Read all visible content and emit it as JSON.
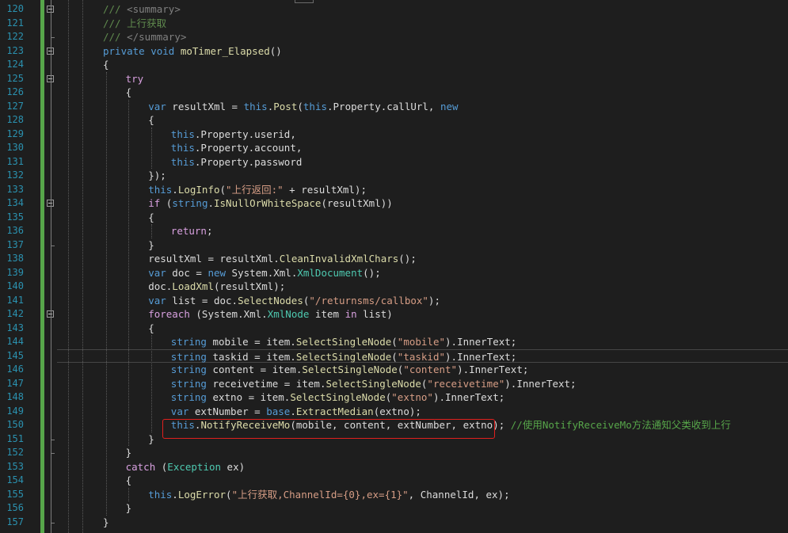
{
  "editor": {
    "language": "C#",
    "theme": "dark",
    "current_line": 145,
    "highlighted_line": 150,
    "lines": [
      {
        "n": 120,
        "tokens": [
          [
            "doc",
            "/// "
          ],
          [
            "docx",
            "<summary>"
          ]
        ]
      },
      {
        "n": 121,
        "tokens": [
          [
            "doc",
            "/// 上行获取"
          ]
        ]
      },
      {
        "n": 122,
        "tokens": [
          [
            "doc",
            "/// "
          ],
          [
            "docx",
            "</summary>"
          ]
        ]
      },
      {
        "n": 123,
        "tokens": [
          [
            "kw",
            "private"
          ],
          [
            "plain",
            " "
          ],
          [
            "kw",
            "void"
          ],
          [
            "plain",
            " "
          ],
          [
            "mth",
            "moTimer_Elapsed"
          ],
          [
            "plain",
            "()"
          ]
        ]
      },
      {
        "n": 124,
        "tokens": [
          [
            "plain",
            "{"
          ]
        ]
      },
      {
        "n": 125,
        "tokens": [
          [
            "ctl",
            "try"
          ]
        ]
      },
      {
        "n": 126,
        "tokens": [
          [
            "plain",
            "{"
          ]
        ]
      },
      {
        "n": 127,
        "tokens": [
          [
            "kw",
            "var"
          ],
          [
            "plain",
            " resultXml = "
          ],
          [
            "kw",
            "this"
          ],
          [
            "plain",
            "."
          ],
          [
            "mth",
            "Post"
          ],
          [
            "plain",
            "("
          ],
          [
            "kw",
            "this"
          ],
          [
            "plain",
            ".Property.callUrl, "
          ],
          [
            "kw",
            "new"
          ]
        ]
      },
      {
        "n": 128,
        "tokens": [
          [
            "plain",
            "{"
          ]
        ]
      },
      {
        "n": 129,
        "tokens": [
          [
            "kw",
            "this"
          ],
          [
            "plain",
            ".Property.userid,"
          ]
        ]
      },
      {
        "n": 130,
        "tokens": [
          [
            "kw",
            "this"
          ],
          [
            "plain",
            ".Property.account,"
          ]
        ]
      },
      {
        "n": 131,
        "tokens": [
          [
            "kw",
            "this"
          ],
          [
            "plain",
            ".Property.password"
          ]
        ]
      },
      {
        "n": 132,
        "tokens": [
          [
            "plain",
            "});"
          ]
        ]
      },
      {
        "n": 133,
        "tokens": [
          [
            "kw",
            "this"
          ],
          [
            "plain",
            "."
          ],
          [
            "mth",
            "LogInfo"
          ],
          [
            "plain",
            "("
          ],
          [
            "str",
            "\"上行返回:\""
          ],
          [
            "plain",
            " + resultXml);"
          ]
        ]
      },
      {
        "n": 134,
        "tokens": [
          [
            "ctl",
            "if"
          ],
          [
            "plain",
            " ("
          ],
          [
            "kw",
            "string"
          ],
          [
            "plain",
            "."
          ],
          [
            "mth",
            "IsNullOrWhiteSpace"
          ],
          [
            "plain",
            "(resultXml))"
          ]
        ]
      },
      {
        "n": 135,
        "tokens": [
          [
            "plain",
            "{"
          ]
        ]
      },
      {
        "n": 136,
        "tokens": [
          [
            "ctl",
            "return"
          ],
          [
            "plain",
            ";"
          ]
        ]
      },
      {
        "n": 137,
        "tokens": [
          [
            "plain",
            "}"
          ]
        ]
      },
      {
        "n": 138,
        "tokens": [
          [
            "plain",
            "resultXml = resultXml."
          ],
          [
            "mth",
            "CleanInvalidXmlChars"
          ],
          [
            "plain",
            "();"
          ]
        ]
      },
      {
        "n": 139,
        "tokens": [
          [
            "kw",
            "var"
          ],
          [
            "plain",
            " doc = "
          ],
          [
            "kw",
            "new"
          ],
          [
            "plain",
            " System.Xml."
          ],
          [
            "type",
            "XmlDocument"
          ],
          [
            "plain",
            "();"
          ]
        ]
      },
      {
        "n": 140,
        "tokens": [
          [
            "plain",
            "doc."
          ],
          [
            "mth",
            "LoadXml"
          ],
          [
            "plain",
            "(resultXml);"
          ]
        ]
      },
      {
        "n": 141,
        "tokens": [
          [
            "kw",
            "var"
          ],
          [
            "plain",
            " list = doc."
          ],
          [
            "mth",
            "SelectNodes"
          ],
          [
            "plain",
            "("
          ],
          [
            "str",
            "\"/returnsms/callbox\""
          ],
          [
            "plain",
            ");"
          ]
        ]
      },
      {
        "n": 142,
        "tokens": [
          [
            "ctl",
            "foreach"
          ],
          [
            "plain",
            " (System.Xml."
          ],
          [
            "type",
            "XmlNode"
          ],
          [
            "plain",
            " item "
          ],
          [
            "ctl",
            "in"
          ],
          [
            "plain",
            " list)"
          ]
        ]
      },
      {
        "n": 143,
        "tokens": [
          [
            "plain",
            "{"
          ]
        ]
      },
      {
        "n": 144,
        "tokens": [
          [
            "kw",
            "string"
          ],
          [
            "plain",
            " mobile = item."
          ],
          [
            "mth",
            "SelectSingleNode"
          ],
          [
            "plain",
            "("
          ],
          [
            "str",
            "\"mobile\""
          ],
          [
            "plain",
            ").InnerText;"
          ]
        ]
      },
      {
        "n": 145,
        "tokens": [
          [
            "kw",
            "string"
          ],
          [
            "plain",
            " taskid = item."
          ],
          [
            "mth",
            "SelectSingleNode"
          ],
          [
            "plain",
            "("
          ],
          [
            "str",
            "\"taskid\""
          ],
          [
            "plain",
            ").InnerText;"
          ]
        ]
      },
      {
        "n": 146,
        "tokens": [
          [
            "kw",
            "string"
          ],
          [
            "plain",
            " content = item."
          ],
          [
            "mth",
            "SelectSingleNode"
          ],
          [
            "plain",
            "("
          ],
          [
            "str",
            "\"content\""
          ],
          [
            "plain",
            ").InnerText;"
          ]
        ]
      },
      {
        "n": 147,
        "tokens": [
          [
            "kw",
            "string"
          ],
          [
            "plain",
            " receivetime = item."
          ],
          [
            "mth",
            "SelectSingleNode"
          ],
          [
            "plain",
            "("
          ],
          [
            "str",
            "\"receivetime\""
          ],
          [
            "plain",
            ").InnerText;"
          ]
        ]
      },
      {
        "n": 148,
        "tokens": [
          [
            "kw",
            "string"
          ],
          [
            "plain",
            " extno = item."
          ],
          [
            "mth",
            "SelectSingleNode"
          ],
          [
            "plain",
            "("
          ],
          [
            "str",
            "\"extno\""
          ],
          [
            "plain",
            ").InnerText;"
          ]
        ]
      },
      {
        "n": 149,
        "tokens": [
          [
            "kw",
            "var"
          ],
          [
            "plain",
            " extNumber = "
          ],
          [
            "kw",
            "base"
          ],
          [
            "plain",
            "."
          ],
          [
            "mth",
            "ExtractMedian"
          ],
          [
            "plain",
            "(extno);"
          ]
        ]
      },
      {
        "n": 150,
        "tokens": [
          [
            "kw",
            "this"
          ],
          [
            "plain",
            "."
          ],
          [
            "mth",
            "NotifyReceiveMo"
          ],
          [
            "plain",
            "(mobile, content, extNumber, extno); "
          ],
          [
            "cmt",
            "//使用NotifyReceiveMo方法通知父类收到上行"
          ]
        ]
      },
      {
        "n": 151,
        "tokens": [
          [
            "plain",
            "}"
          ]
        ]
      },
      {
        "n": 152,
        "tokens": [
          [
            "plain",
            "}"
          ]
        ]
      },
      {
        "n": 153,
        "tokens": [
          [
            "ctl",
            "catch"
          ],
          [
            "plain",
            " ("
          ],
          [
            "type",
            "Exception"
          ],
          [
            "plain",
            " ex)"
          ]
        ]
      },
      {
        "n": 154,
        "tokens": [
          [
            "plain",
            "{"
          ]
        ]
      },
      {
        "n": 155,
        "tokens": [
          [
            "kw",
            "this"
          ],
          [
            "plain",
            "."
          ],
          [
            "mth",
            "LogError"
          ],
          [
            "plain",
            "("
          ],
          [
            "str",
            "\"上行获取,ChannelId={0},ex={1}\""
          ],
          [
            "plain",
            ", ChannelId, ex);"
          ]
        ]
      },
      {
        "n": 156,
        "tokens": [
          [
            "plain",
            "}"
          ]
        ]
      },
      {
        "n": 157,
        "tokens": [
          [
            "plain",
            "}"
          ]
        ]
      }
    ]
  },
  "colors": {
    "background": "#1e1e1e",
    "line_number": "#2b91af",
    "keyword": "#569cd6",
    "control": "#d8a0df",
    "type": "#4ec9b0",
    "string": "#d69d85",
    "comment": "#57a64a",
    "method": "#dcdcaa",
    "text": "#dcdcdc",
    "annotation_box": "#e0201e",
    "change_bar": "#57a64a"
  }
}
